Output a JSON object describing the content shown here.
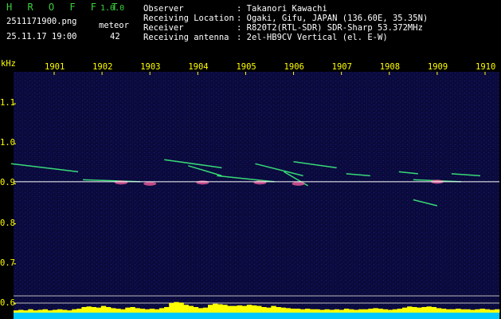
{
  "header": {
    "app_name": "H R O F F T",
    "version": "1.0.0",
    "filename": "2511171900.png",
    "datetime": "25.11.17 19:00",
    "meteor_label": "meteor",
    "meteor_count": "42",
    "info": [
      {
        "label": "Observer",
        "value": ": Takanori Kawachi"
      },
      {
        "label": "Receiving Location",
        "value": ": Ogaki, Gifu, JAPAN (136.60E, 35.35N)"
      },
      {
        "label": "Receiver",
        "value": ": R820T2(RTL-SDR) SDR-Sharp 53.372MHz"
      },
      {
        "label": "Receiving antenna",
        "value": ": 2el-HB9CV Vertical (el. E-W)"
      }
    ]
  },
  "colors": {
    "background": "#000000",
    "plot_background": "#0a0a3c",
    "axis_text": "#ffff00",
    "app_name": "#3cd23c",
    "reference_line": "#ffffff",
    "meteor_trace": "#40ff80",
    "level_fill": "#ffff00",
    "level_base": "#00c8ff"
  },
  "chart_data": {
    "type": "heatmap",
    "ylabel": "kHz",
    "x_ticks": [
      "1901",
      "1902",
      "1903",
      "1904",
      "1905",
      "1906",
      "1907",
      "1908",
      "1909",
      "1910"
    ],
    "y_ticks": [
      "1.1",
      "1.0",
      "0.9",
      "0.8",
      "0.7",
      "0.6"
    ],
    "xlim": [
      1900,
      1910
    ],
    "ylim": [
      0.58,
      1.2
    ],
    "carrier_khz": 0.905,
    "meteor_traces": [
      {
        "x": [
          1900.1,
          1901.5
        ],
        "y": [
          0.95,
          0.93
        ]
      },
      {
        "x": [
          1901.6,
          1902.8
        ],
        "y": [
          0.91,
          0.905
        ]
      },
      {
        "x": [
          1903.3,
          1904.5
        ],
        "y": [
          0.96,
          0.94
        ]
      },
      {
        "x": [
          1903.8,
          1904.5
        ],
        "y": [
          0.945,
          0.92
        ]
      },
      {
        "x": [
          1904.4,
          1905.6
        ],
        "y": [
          0.92,
          0.905
        ]
      },
      {
        "x": [
          1905.2,
          1906.2
        ],
        "y": [
          0.95,
          0.92
        ]
      },
      {
        "x": [
          1905.8,
          1906.3
        ],
        "y": [
          0.93,
          0.895
        ]
      },
      {
        "x": [
          1906.0,
          1906.9
        ],
        "y": [
          0.955,
          0.94
        ]
      },
      {
        "x": [
          1907.1,
          1907.6
        ],
        "y": [
          0.925,
          0.92
        ]
      },
      {
        "x": [
          1908.2,
          1908.6
        ],
        "y": [
          0.93,
          0.925
        ]
      },
      {
        "x": [
          1908.5,
          1909.0
        ],
        "y": [
          0.86,
          0.845
        ]
      },
      {
        "x": [
          1909.3,
          1909.9
        ],
        "y": [
          0.925,
          0.92
        ]
      },
      {
        "x": [
          1908.5,
          1909.5
        ],
        "y": [
          0.91,
          0.905
        ]
      }
    ],
    "hot_spots": [
      {
        "x": 1902.4,
        "y": 0.903
      },
      {
        "x": 1903.0,
        "y": 0.9
      },
      {
        "x": 1904.1,
        "y": 0.903
      },
      {
        "x": 1905.3,
        "y": 0.903
      },
      {
        "x": 1906.1,
        "y": 0.9
      },
      {
        "x": 1909.0,
        "y": 0.905
      }
    ],
    "level_series": [
      0.2,
      0.25,
      0.2,
      0.3,
      0.2,
      0.25,
      0.3,
      0.2,
      0.25,
      0.3,
      0.25,
      0.2,
      0.3,
      0.35,
      0.5,
      0.55,
      0.5,
      0.45,
      0.6,
      0.5,
      0.4,
      0.35,
      0.3,
      0.45,
      0.5,
      0.4,
      0.35,
      0.3,
      0.35,
      0.3,
      0.4,
      0.5,
      0.85,
      0.95,
      0.9,
      0.7,
      0.6,
      0.5,
      0.4,
      0.45,
      0.7,
      0.8,
      0.75,
      0.7,
      0.6,
      0.6,
      0.65,
      0.6,
      0.7,
      0.65,
      0.6,
      0.5,
      0.45,
      0.6,
      0.5,
      0.45,
      0.4,
      0.35,
      0.35,
      0.3,
      0.35,
      0.3,
      0.3,
      0.25,
      0.3,
      0.25,
      0.3,
      0.25,
      0.35,
      0.3,
      0.25,
      0.3,
      0.3,
      0.35,
      0.4,
      0.35,
      0.3,
      0.25,
      0.3,
      0.35,
      0.45,
      0.55,
      0.5,
      0.45,
      0.5,
      0.55,
      0.5,
      0.4,
      0.35,
      0.3,
      0.3,
      0.35,
      0.3,
      0.3,
      0.25,
      0.3,
      0.35,
      0.3,
      0.25,
      0.3
    ]
  }
}
